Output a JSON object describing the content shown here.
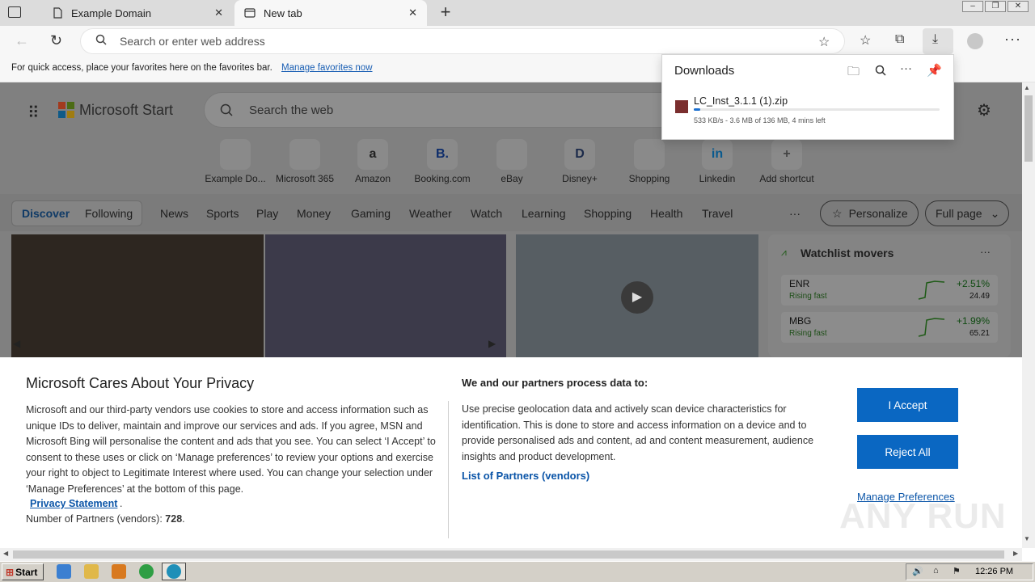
{
  "tabs": [
    {
      "title": "Example Domain",
      "close": "✕"
    },
    {
      "title": "New tab",
      "close": "✕"
    }
  ],
  "new_tab_label": "+",
  "toolbar": {
    "back": "←",
    "refresh": "↻",
    "address_placeholder": "Search or enter web address",
    "more": "···"
  },
  "favorites_bar": {
    "text": "For quick access, place your favorites here on the favorites bar.",
    "link": "Manage favorites now"
  },
  "downloads": {
    "title": "Downloads",
    "file_name": "LC_Inst_3.1.1 (1).zip",
    "status": "533 KB/s - 3.6 MB of 136 MB, 4 mins left",
    "progress_fraction": 0.026
  },
  "msstart": {
    "brand": "Microsoft Start",
    "search_placeholder": "Search the web",
    "shortcuts": [
      {
        "label": "Example Do...",
        "glyph": "",
        "color": "#9a9a9a"
      },
      {
        "label": "Microsoft 365",
        "glyph": "",
        "color": "#5b4fa8"
      },
      {
        "label": "Amazon",
        "glyph": "a",
        "color": "#222222"
      },
      {
        "label": "Booking.com",
        "glyph": "B.",
        "color": "#0e2d6b"
      },
      {
        "label": "eBay",
        "glyph": "",
        "color": "#b43030"
      },
      {
        "label": "Disney+",
        "glyph": "D",
        "color": "#1b2a4a"
      },
      {
        "label": "Shopping",
        "glyph": "",
        "color": "#b3262c"
      },
      {
        "label": "Linkedin",
        "glyph": "in",
        "color": "#0a5a8e"
      },
      {
        "label": "Add shortcut",
        "glyph": "+",
        "color": "#444444"
      }
    ],
    "segment": [
      "Discover",
      "Following"
    ],
    "nav": [
      "News",
      "Sports",
      "Play",
      "Money",
      "Gaming",
      "Weather",
      "Watch",
      "Learning",
      "Shopping",
      "Health",
      "Travel",
      "···"
    ],
    "personalize": "Personalize",
    "full_page": "Full page",
    "watchlist": {
      "title": "Watchlist movers",
      "more": "···",
      "stocks": [
        {
          "symbol": "ENR",
          "sub": "Rising fast",
          "change": "+2.51%",
          "price": "24.49"
        },
        {
          "symbol": "MBG",
          "sub": "Rising fast",
          "change": "+1.99%",
          "price": "65.21"
        }
      ]
    }
  },
  "privacy": {
    "title": "Microsoft Cares About Your Privacy",
    "body": "Microsoft and our third-party vendors use cookies to store and access information such as unique IDs to deliver, maintain and improve our services and ads. If you agree, MSN and Microsoft Bing will personalise the content and ads that you see. You can select ‘I Accept’ to consent to these uses or click on ‘Manage preferences’ to review your options and exercise your right to object to Legitimate Interest where used.  You can change your selection under ‘Manage Preferences’ at the bottom of this page.",
    "privacy_link": "Privacy Statement",
    "partners_label": "Number of Partners (vendors): ",
    "partners_count": "728",
    "sub_title": "We and our partners process data to:",
    "sub_body": "Use precise geolocation data and actively scan device characteristics for identification. This is done to store and access information on a device and to provide personalised ads and content, ad and content measurement, audience insights and product development.",
    "list_link": "List of Partners (vendors)",
    "accept": "I Accept",
    "reject": "Reject All",
    "manage": "Manage Preferences"
  },
  "watermark": "ANY RUN",
  "taskbar": {
    "start": "Start",
    "clock": "12:26 PM"
  }
}
